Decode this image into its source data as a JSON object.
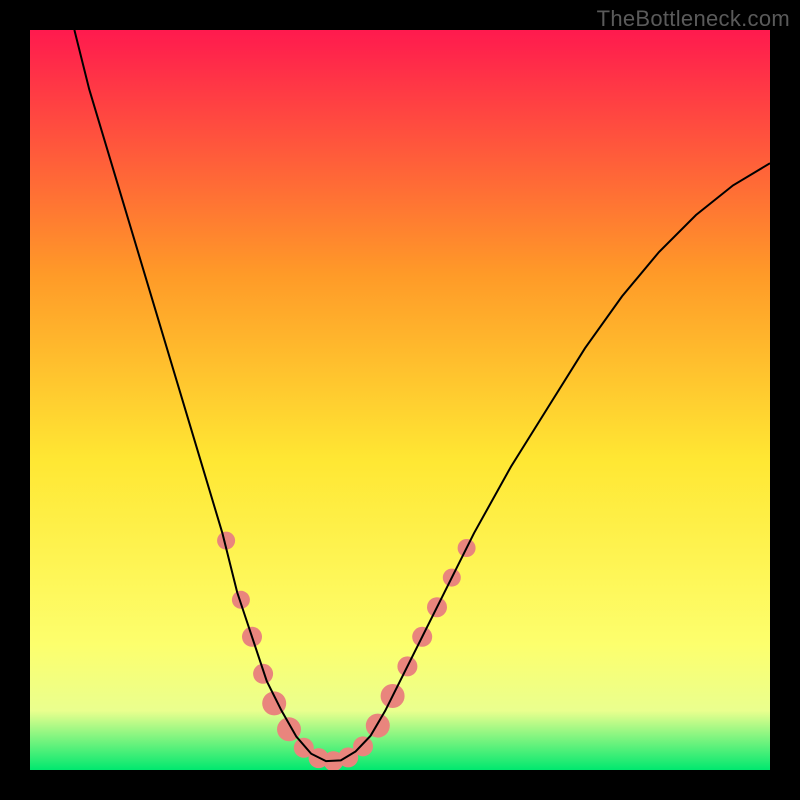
{
  "watermark": "TheBottleneck.com",
  "chart_data": {
    "type": "line",
    "title": "",
    "xlabel": "",
    "ylabel": "",
    "xlim": [
      0,
      100
    ],
    "ylim": [
      0,
      100
    ],
    "background_gradient": {
      "top": "#ff1a4e",
      "upper_mid": "#ff9a28",
      "mid": "#ffe733",
      "lower_mid": "#fdff6d",
      "bottom": "#00e86f"
    },
    "series": [
      {
        "name": "v-curve",
        "stroke": "#000000",
        "stroke_width": 2,
        "points": [
          [
            6,
            100
          ],
          [
            8,
            92
          ],
          [
            11,
            82
          ],
          [
            14,
            72
          ],
          [
            17,
            62
          ],
          [
            20,
            52
          ],
          [
            23,
            42
          ],
          [
            26,
            32
          ],
          [
            28,
            24
          ],
          [
            30,
            18
          ],
          [
            32,
            12
          ],
          [
            34,
            8
          ],
          [
            36,
            4.5
          ],
          [
            38,
            2.2
          ],
          [
            40,
            1.2
          ],
          [
            42,
            1.3
          ],
          [
            44,
            2.5
          ],
          [
            46,
            4.6
          ],
          [
            48,
            8
          ],
          [
            50,
            12
          ],
          [
            53,
            18
          ],
          [
            56,
            24
          ],
          [
            60,
            32
          ],
          [
            65,
            41
          ],
          [
            70,
            49
          ],
          [
            75,
            57
          ],
          [
            80,
            64
          ],
          [
            85,
            70
          ],
          [
            90,
            75
          ],
          [
            95,
            79
          ],
          [
            100,
            82
          ]
        ]
      }
    ],
    "markers": {
      "name": "highlight-dots-left",
      "fill": "#e9857d",
      "points_left": [
        [
          26.5,
          31,
          9
        ],
        [
          28.5,
          23,
          9
        ],
        [
          30,
          18,
          10
        ],
        [
          31.5,
          13,
          10
        ],
        [
          33,
          9,
          12
        ],
        [
          35,
          5.5,
          12
        ],
        [
          37,
          3,
          10
        ],
        [
          39,
          1.6,
          10
        ],
        [
          41,
          1.2,
          10
        ],
        [
          43,
          1.7,
          10
        ]
      ],
      "points_right": [
        [
          45,
          3.2,
          10
        ],
        [
          47,
          6,
          12
        ],
        [
          49,
          10,
          12
        ],
        [
          51,
          14,
          10
        ],
        [
          53,
          18,
          10
        ],
        [
          55,
          22,
          10
        ],
        [
          57,
          26,
          9
        ],
        [
          59,
          30,
          9
        ]
      ]
    }
  }
}
